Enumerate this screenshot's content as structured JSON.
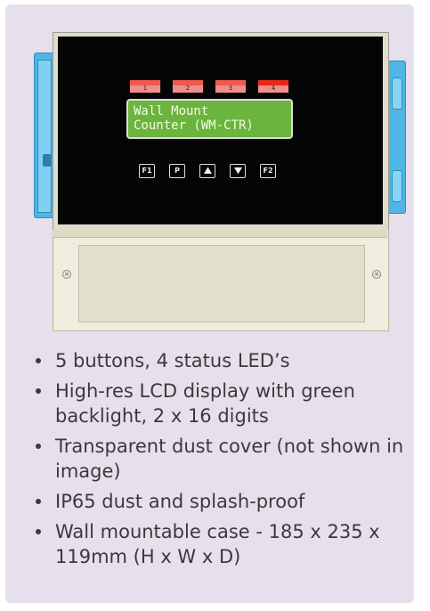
{
  "device": {
    "leds": [
      {
        "label": "1",
        "state": "off"
      },
      {
        "label": "2",
        "state": "off"
      },
      {
        "label": "3",
        "state": "off"
      },
      {
        "label": "4",
        "state": "on"
      }
    ],
    "lcd": {
      "line1": "Wall Mount",
      "line2": "Counter (WM-CTR)"
    },
    "buttons": [
      {
        "label": "F1",
        "icon": ""
      },
      {
        "label": "P",
        "icon": ""
      },
      {
        "label": "",
        "icon": "up-arrow-icon"
      },
      {
        "label": "",
        "icon": "down-arrow-icon"
      },
      {
        "label": "F2",
        "icon": ""
      }
    ],
    "colors": {
      "case_rail": "#4fb6e6",
      "lcd_backlight": "#6bb43d",
      "led_off": "#f08f8a",
      "led_on": "#e8281c",
      "card_background": "#e6e0ed"
    }
  },
  "features": [
    "5 buttons, 4 status LED’s",
    "High-res LCD display with green backlight, 2 x 16 digits",
    "Transparent dust cover (not shown in image)",
    "IP65 dust and splash-proof",
    "Wall mountable case - 185 x 235 x 119mm (H x W x D)"
  ]
}
